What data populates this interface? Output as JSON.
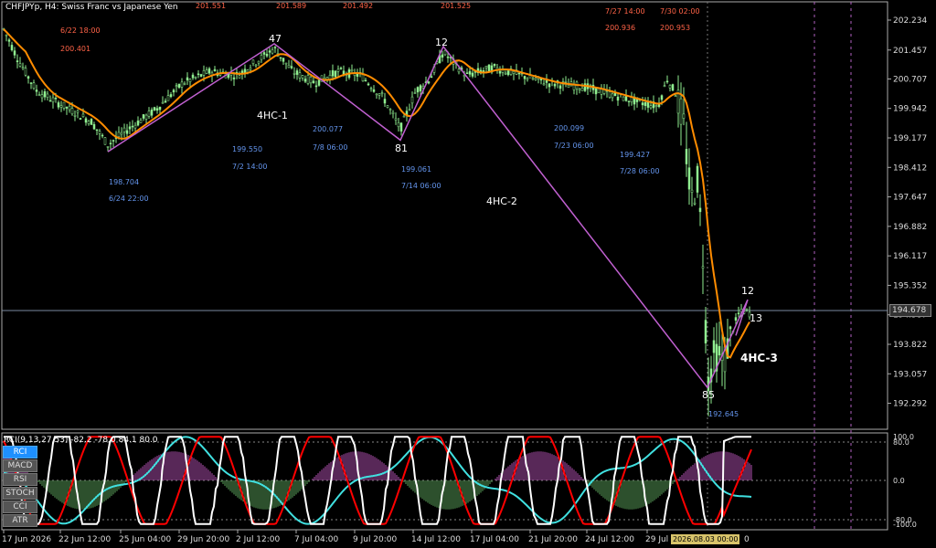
{
  "header": {
    "title": "CHFJPYp, H4:  Swiss Franc vs Japanese Yen"
  },
  "indicator": {
    "label": "RCI(9,13,27,53) -82.2 -78.0 84.1 80.0",
    "buttons": [
      "RCI",
      "MACD",
      "RSI",
      "STOCH",
      "CCI",
      "ATR"
    ],
    "active": "RCI"
  },
  "price_axis": {
    "ticks": [
      "202.234",
      "201.457",
      "200.707",
      "199.942",
      "199.177",
      "198.412",
      "197.647",
      "196.882",
      "196.117",
      "195.352",
      "194.587",
      "193.822",
      "193.057",
      "192.292"
    ],
    "current_price": "194.678"
  },
  "indicator_axis": {
    "ticks": [
      "100.0",
      "80.0",
      "0.0",
      "-80.0",
      "-100.0"
    ]
  },
  "time_axis": {
    "ticks": [
      "17 Jun 2026",
      "22 Jun 12:00",
      "25 Jun 04:00",
      "29 Jun 20:00",
      "2 Jul 12:00",
      "7 Jul 04:00",
      "9 Jul 20:00",
      "14 Jul 12:00",
      "17 Jul 04:00",
      "21 Jul 20:00",
      "24 Jul 12:00",
      "29 Jul 04:00"
    ],
    "cursor_label": "2026.08.03 00:00",
    "trailing_char": "0"
  },
  "top_partial_labels": [
    "201.551",
    "201.589",
    "201.492",
    "201.525"
  ],
  "annotations": {
    "swing_labels": [
      {
        "text": "6/22 18:00",
        "color": "#ff6347"
      },
      {
        "text": "200.401",
        "color": "#ff6347"
      },
      {
        "text": "198.704",
        "color": "#6495ed"
      },
      {
        "text": "6/24 22:00",
        "color": "#6495ed"
      },
      {
        "text": "199.550",
        "color": "#6495ed"
      },
      {
        "text": "7/2 14:00",
        "color": "#6495ed"
      },
      {
        "text": "200.077",
        "color": "#6495ed"
      },
      {
        "text": "7/8 06:00",
        "color": "#6495ed"
      },
      {
        "text": "199.061",
        "color": "#6495ed"
      },
      {
        "text": "7/14 06:00",
        "color": "#6495ed"
      },
      {
        "text": "200.099",
        "color": "#6495ed"
      },
      {
        "text": "7/23 06:00",
        "color": "#6495ed"
      },
      {
        "text": "199.427",
        "color": "#6495ed"
      },
      {
        "text": "7/28 06:00",
        "color": "#6495ed"
      },
      {
        "text": "7/27 14:00",
        "color": "#ff6347"
      },
      {
        "text": "7/30 02:00",
        "color": "#ff6347"
      },
      {
        "text": "200.936",
        "color": "#ff6347"
      },
      {
        "text": "200.953",
        "color": "#ff6347"
      },
      {
        "text": "192.645",
        "color": "#6495ed"
      }
    ],
    "wave_counts": [
      "47",
      "81",
      "12",
      "85",
      "12",
      "13"
    ],
    "wave_names": [
      "4HC-1",
      "4HC-2",
      "4HC-3"
    ]
  },
  "colors": {
    "moving_average": "#ff8c00",
    "zigzag": "#c060d0",
    "candles": "#90ee90",
    "rci_short": "#ffffff",
    "rci_mid": "#ff0000",
    "rci_long": "#40e0e0",
    "histogram_up": "#5aa05a",
    "histogram_down": "#b050b0"
  },
  "chart_data": {
    "type": "line",
    "title": "CHFJPYp, H4:  Swiss Franc vs Japanese Yen",
    "ylim": [
      191.9,
      202.6
    ],
    "zigzag": [
      {
        "date": "6/24 22:00",
        "price": 198.704
      },
      {
        "date": "7/2 14:00",
        "price": 201.55
      },
      {
        "date": "7/14 06:00",
        "price": 199.061
      },
      {
        "date": "7/16",
        "price": 201.525
      },
      {
        "date": "8/03",
        "price": 192.645
      },
      {
        "date": "8/04",
        "price": 194.95
      },
      {
        "date": "8/04",
        "price": 194.1
      }
    ],
    "price_approx": [
      [
        "6/17",
        202.1
      ],
      [
        "6/19",
        200.9
      ],
      [
        "6/22",
        200.4
      ],
      [
        "6/24",
        198.9
      ],
      [
        "6/26",
        199.8
      ],
      [
        "6/29",
        200.5
      ],
      [
        "7/1",
        200.9
      ],
      [
        "7/2",
        201.55
      ],
      [
        "7/6",
        200.7
      ],
      [
        "7/8",
        200.1
      ],
      [
        "7/10",
        200.8
      ],
      [
        "7/13",
        200.4
      ],
      [
        "7/14",
        199.1
      ],
      [
        "7/16",
        201.5
      ],
      [
        "7/20",
        200.7
      ],
      [
        "7/23",
        200.1
      ],
      [
        "7/27",
        200.0
      ],
      [
        "7/29",
        199.5
      ],
      [
        "7/30",
        200.9
      ],
      [
        "7/31",
        197.0
      ],
      [
        "8/03",
        192.7
      ],
      [
        "8/04",
        194.7
      ]
    ]
  }
}
